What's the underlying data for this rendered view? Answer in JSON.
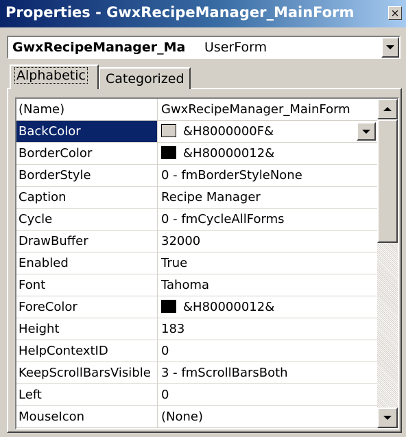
{
  "window": {
    "title": "Properties - GwxRecipeManager_MainForm",
    "close_glyph": "×"
  },
  "object_selector": {
    "name": "GwxRecipeManager_Ma",
    "type": "UserForm"
  },
  "tabs": [
    {
      "label": "Alphabetic",
      "active": true
    },
    {
      "label": "Categorized",
      "active": false
    }
  ],
  "properties": [
    {
      "name": "(Name)",
      "value": "GwxRecipeManager_MainForm",
      "swatch": null
    },
    {
      "name": "BackColor",
      "value": "&H8000000F&",
      "swatch": "#d4d0c8",
      "selected": true
    },
    {
      "name": "BorderColor",
      "value": "&H80000012&",
      "swatch": "#000000"
    },
    {
      "name": "BorderStyle",
      "value": "0 - fmBorderStyleNone",
      "swatch": null
    },
    {
      "name": "Caption",
      "value": "Recipe Manager",
      "swatch": null
    },
    {
      "name": "Cycle",
      "value": "0 - fmCycleAllForms",
      "swatch": null
    },
    {
      "name": "DrawBuffer",
      "value": "32000",
      "swatch": null
    },
    {
      "name": "Enabled",
      "value": "True",
      "swatch": null
    },
    {
      "name": "Font",
      "value": "Tahoma",
      "swatch": null
    },
    {
      "name": "ForeColor",
      "value": "&H80000012&",
      "swatch": "#000000"
    },
    {
      "name": "Height",
      "value": "183",
      "swatch": null
    },
    {
      "name": "HelpContextID",
      "value": "0",
      "swatch": null
    },
    {
      "name": "KeepScrollBarsVisible",
      "value": "3 - fmScrollBarsBoth",
      "swatch": null
    },
    {
      "name": "Left",
      "value": "0",
      "swatch": null
    },
    {
      "name": "MouseIcon",
      "value": "(None)",
      "swatch": null
    }
  ],
  "colors": {
    "selection": "#0a246a",
    "face": "#d4d0c8"
  }
}
